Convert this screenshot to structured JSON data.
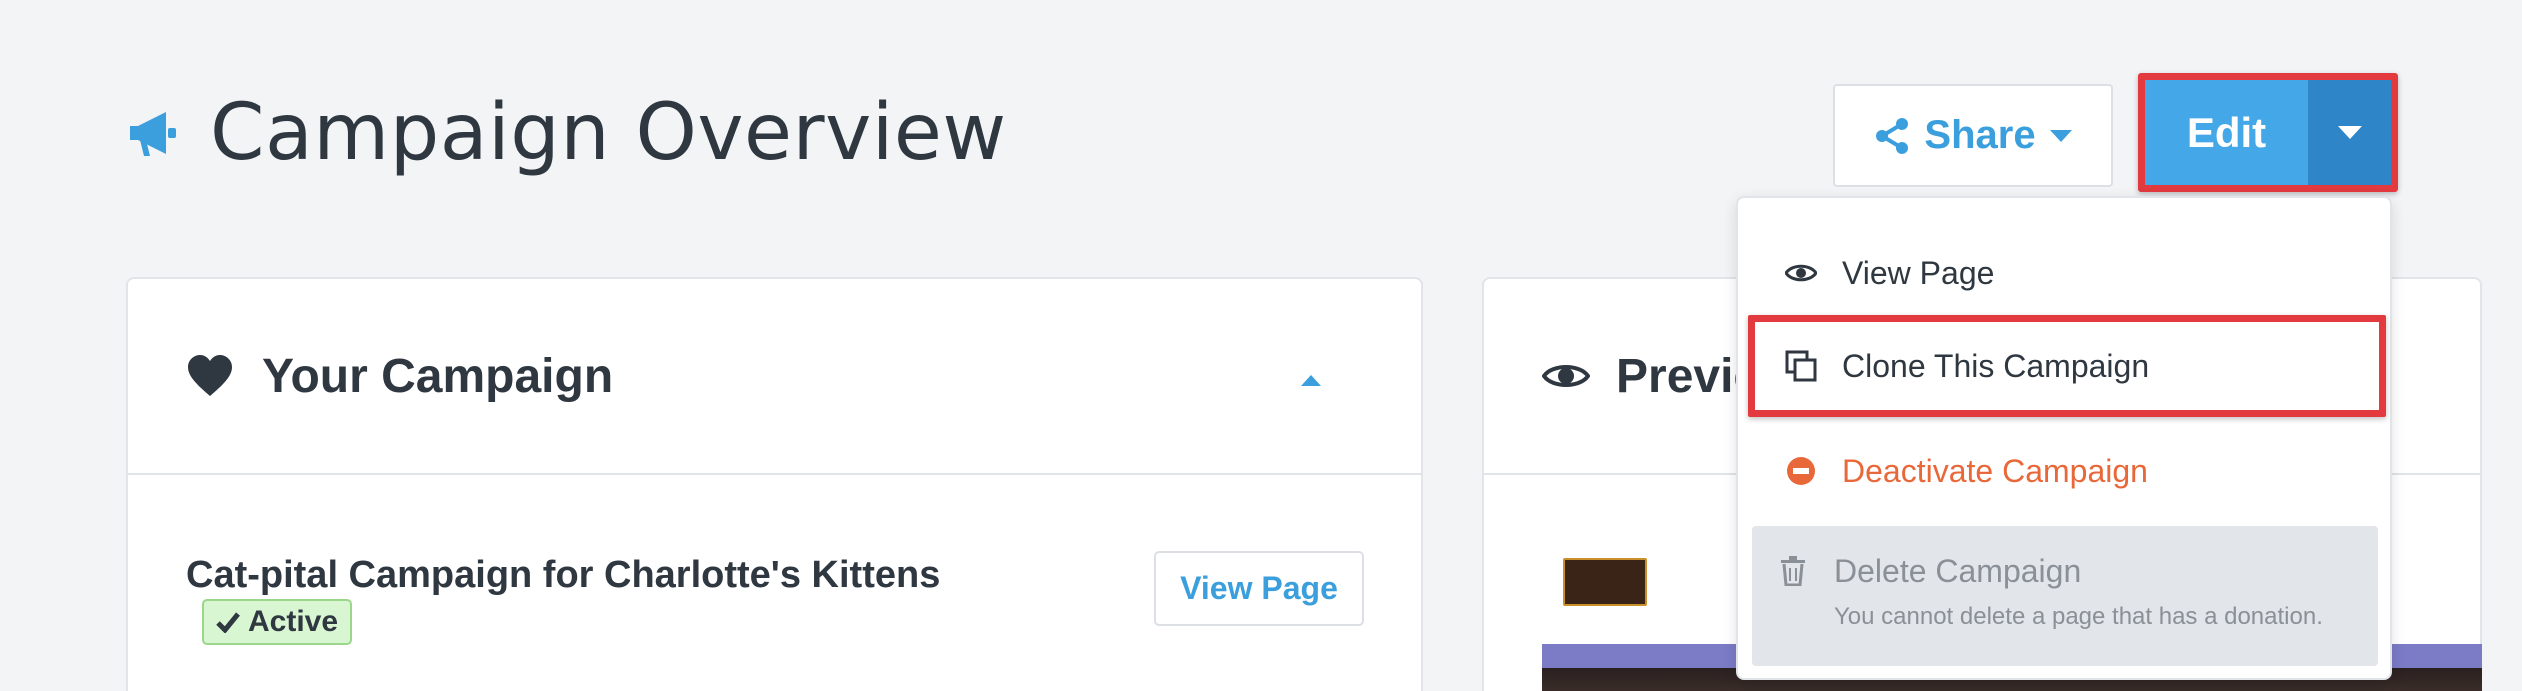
{
  "header": {
    "title": "Campaign Overview",
    "share_label": "Share",
    "edit_label": "Edit"
  },
  "dropdown": {
    "view_page": "View Page",
    "clone": "Clone This Campaign",
    "deactivate": "Deactivate Campaign",
    "delete": "Delete Campaign",
    "delete_note": "You cannot delete a page that has a donation."
  },
  "campaign_panel": {
    "title": "Your Campaign",
    "campaign_name": "Cat-pital Campaign for Charlotte's Kittens",
    "status": "Active",
    "view_page_label": "View Page"
  },
  "preview_panel": {
    "title": "Previe"
  },
  "colors": {
    "accent": "#3a9fdc",
    "edit_button": "#44a8e8",
    "edit_toggle": "#2e86c9",
    "highlight": "#e23a3e",
    "danger": "#e8683a",
    "active_badge": "#d9f6d2"
  },
  "icons": [
    "megaphone-icon",
    "share-icon",
    "chevron-down-icon",
    "heart-icon",
    "eye-icon",
    "clone-icon",
    "minus-circle-icon",
    "trash-icon",
    "check-icon"
  ]
}
